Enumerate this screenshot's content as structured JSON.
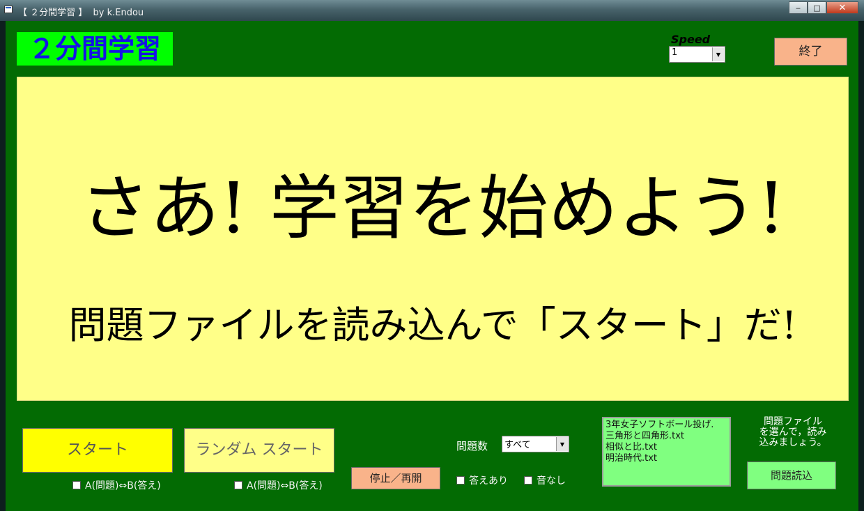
{
  "window": {
    "title": "【 ２分間学習 】  by k.Endou",
    "controls": {
      "minimize": "‒",
      "maximize": "□",
      "close": "✕"
    }
  },
  "header": {
    "app_title": "２分間学習",
    "speed_label": "Speed",
    "speed_value": "1",
    "quit_label": "終了"
  },
  "display": {
    "main_message": "さあ! 学習を始めよう!",
    "sub_message": "問題ファイルを読み込んで「スタート」だ!"
  },
  "controls": {
    "start_label": "スタート",
    "random_start_label": "ランダム スタート",
    "swap_label_1": "A(問題)⇔B(答え)",
    "swap_label_2": "A(問題)⇔B(答え)",
    "stop_resume_label": "停止／再開",
    "question_count_label": "問題数",
    "question_count_value": "すべて",
    "show_answer_label": "答えあり",
    "mute_label": "音なし"
  },
  "files": {
    "items": [
      "3年女子ソフトボール投げ.",
      "三角形と四角形.txt",
      "相似と比.txt",
      "明治時代.txt"
    ],
    "hint_lines": [
      "問題ファイル",
      "を選んで，読み",
      "込みましょう。"
    ],
    "load_label": "問題読込"
  },
  "colors": {
    "form_bg": "#036b03",
    "display_bg": "#ffff88",
    "title_bg": "#00ff00",
    "title_text": "#1414e6",
    "start_bg": "#ffff00",
    "orange_button": "#f9b38a",
    "file_list_bg": "#80ff80"
  }
}
